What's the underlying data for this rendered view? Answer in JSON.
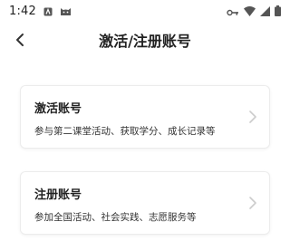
{
  "status_bar": {
    "time": "1:42",
    "icons": [
      "notification-a-icon",
      "cat-icon",
      "key-icon",
      "wifi-icon",
      "signal-icon",
      "battery-icon"
    ]
  },
  "header": {
    "title": "激活/注册账号",
    "back_icon": "chevron-left-icon"
  },
  "options": [
    {
      "title": "激活账号",
      "description": "参与第二课堂活动、获取学分、成长记录等"
    },
    {
      "title": "注册账号",
      "description": "参加全国活动、社会实践、志愿服务等"
    }
  ],
  "colors": {
    "background": "#ffffff",
    "text": "#222222",
    "card_border": "#ececec",
    "chevron": "#cccccc"
  }
}
